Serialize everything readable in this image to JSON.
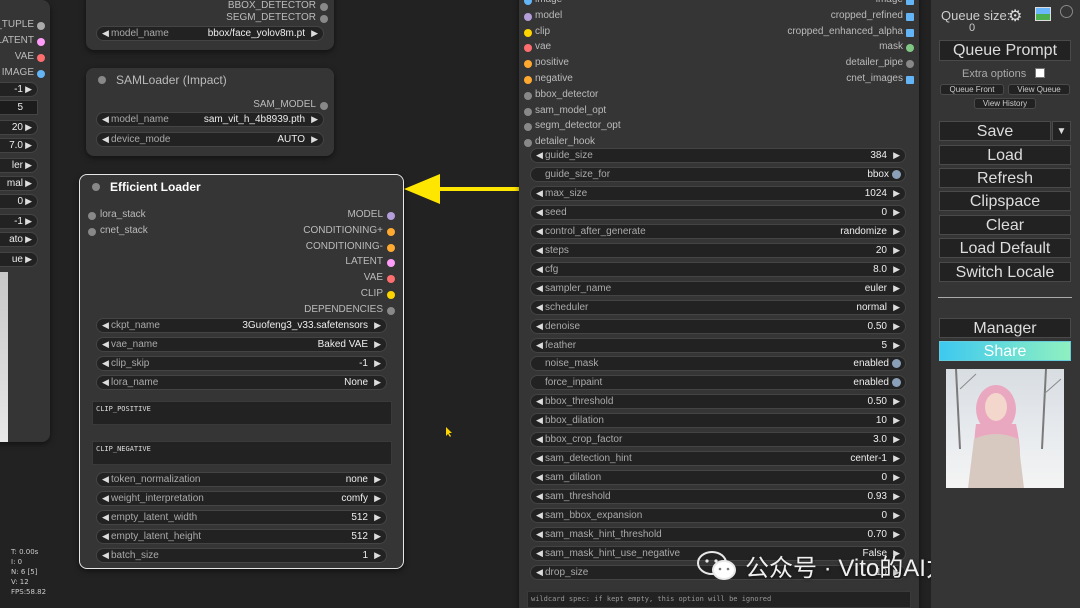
{
  "left_strip": {
    "outputs": [
      {
        "label": "_TUPLE",
        "color": "#aaaaaa"
      },
      {
        "label": "LATENT",
        "color": "#ff9cf9"
      },
      {
        "label": "VAE",
        "color": "#ff6e6e"
      },
      {
        "label": "IMAGE",
        "color": "#64b5f6"
      }
    ],
    "widget_values": [
      "-1",
      "5",
      "20",
      "7.0",
      "ler",
      "mal",
      "0",
      "-1",
      "ato",
      "ue"
    ]
  },
  "top_node": {
    "outputs": [
      "BBOX_DETECTOR",
      "SEGM_DETECTOR"
    ],
    "model_name_label": "model_name",
    "model_name_value": "bbox/face_yolov8m.pt"
  },
  "sam_loader": {
    "title": "SAMLoader (Impact)",
    "output": "SAM_MODEL",
    "model_name_label": "model_name",
    "model_name_value": "sam_vit_h_4b8939.pth",
    "device_mode_label": "device_mode",
    "device_mode_value": "AUTO"
  },
  "efficient_loader": {
    "title": "Efficient Loader",
    "inputs": [
      "lora_stack",
      "cnet_stack"
    ],
    "outputs": [
      {
        "label": "MODEL",
        "color": "#b39ddb"
      },
      {
        "label": "CONDITIONING+",
        "color": "#ffa931"
      },
      {
        "label": "CONDITIONING-",
        "color": "#ffa931"
      },
      {
        "label": "LATENT",
        "color": "#ff9cf9"
      },
      {
        "label": "VAE",
        "color": "#ff6e6e"
      },
      {
        "label": "CLIP",
        "color": "#ffd500"
      },
      {
        "label": "DEPENDENCIES",
        "color": "#888888"
      }
    ],
    "widgets_top": [
      {
        "label": "ckpt_name",
        "value": "3Guofeng3_v33.safetensors"
      },
      {
        "label": "vae_name",
        "value": "Baked VAE"
      },
      {
        "label": "clip_skip",
        "value": "-1"
      },
      {
        "label": "lora_name",
        "value": "None"
      }
    ],
    "clip_positive_label": "CLIP_POSITIVE",
    "clip_negative_label": "CLIP_NEGATIVE",
    "widgets_bottom": [
      {
        "label": "token_normalization",
        "value": "none"
      },
      {
        "label": "weight_interpretation",
        "value": "comfy"
      },
      {
        "label": "empty_latent_width",
        "value": "512"
      },
      {
        "label": "empty_latent_height",
        "value": "512"
      },
      {
        "label": "batch_size",
        "value": "1"
      }
    ]
  },
  "detailer_node": {
    "top_inputs": [
      {
        "label": "image",
        "color": "#64b5f6"
      },
      {
        "label": "model",
        "color": "#b39ddb"
      },
      {
        "label": "clip",
        "color": "#ffd500"
      },
      {
        "label": "vae",
        "color": "#ff6e6e"
      },
      {
        "label": "positive",
        "color": "#ffa931"
      },
      {
        "label": "negative",
        "color": "#ffa931"
      },
      {
        "label": "bbox_detector",
        "color": "#888888"
      },
      {
        "label": "sam_model_opt",
        "color": "#888888"
      },
      {
        "label": "segm_detector_opt",
        "color": "#888888"
      },
      {
        "label": "detailer_hook",
        "color": "#888888"
      }
    ],
    "top_outputs": [
      {
        "label": "image",
        "color": "#64b5f6"
      },
      {
        "label": "cropped_refined",
        "color": "#64b5f6"
      },
      {
        "label": "cropped_enhanced_alpha",
        "color": "#64b5f6"
      },
      {
        "label": "mask",
        "color": "#81c784"
      },
      {
        "label": "detailer_pipe",
        "color": "#888888"
      },
      {
        "label": "cnet_images",
        "color": "#64b5f6"
      }
    ],
    "widgets": [
      {
        "label": "guide_size",
        "value": "384",
        "toggle": false
      },
      {
        "label": "guide_size_for",
        "value": "bbox",
        "toggle": true
      },
      {
        "label": "max_size",
        "value": "1024",
        "toggle": false
      },
      {
        "label": "seed",
        "value": "0",
        "toggle": false
      },
      {
        "label": "control_after_generate",
        "value": "randomize",
        "toggle": false
      },
      {
        "label": "steps",
        "value": "20",
        "toggle": false
      },
      {
        "label": "cfg",
        "value": "8.0",
        "toggle": false
      },
      {
        "label": "sampler_name",
        "value": "euler",
        "toggle": false
      },
      {
        "label": "scheduler",
        "value": "normal",
        "toggle": false
      },
      {
        "label": "denoise",
        "value": "0.50",
        "toggle": false
      },
      {
        "label": "feather",
        "value": "5",
        "toggle": false
      },
      {
        "label": "noise_mask",
        "value": "enabled",
        "toggle": true
      },
      {
        "label": "force_inpaint",
        "value": "enabled",
        "toggle": true
      },
      {
        "label": "bbox_threshold",
        "value": "0.50",
        "toggle": false
      },
      {
        "label": "bbox_dilation",
        "value": "10",
        "toggle": false
      },
      {
        "label": "bbox_crop_factor",
        "value": "3.0",
        "toggle": false
      },
      {
        "label": "sam_detection_hint",
        "value": "center-1",
        "toggle": false
      },
      {
        "label": "sam_dilation",
        "value": "0",
        "toggle": false
      },
      {
        "label": "sam_threshold",
        "value": "0.93",
        "toggle": false
      },
      {
        "label": "sam_bbox_expansion",
        "value": "0",
        "toggle": false
      },
      {
        "label": "sam_mask_hint_threshold",
        "value": "0.70",
        "toggle": false
      },
      {
        "label": "sam_mask_hint_use_negative",
        "value": "False",
        "toggle": false
      },
      {
        "label": "drop_size",
        "value": "10",
        "toggle": false
      }
    ],
    "wildcard_text": "wildcard spec: if kept empty, this option will be ignored"
  },
  "menu": {
    "queue_size_label": "Queue size:",
    "queue_size_value": "0",
    "queue_prompt": "Queue Prompt",
    "extra_options": "Extra options",
    "queue_front": "Queue Front",
    "view_queue": "View Queue",
    "view_history": "View History",
    "save": "Save",
    "load": "Load",
    "refresh": "Refresh",
    "clipspace": "Clipspace",
    "clear": "Clear",
    "load_default": "Load Default",
    "switch_locale": "Switch Locale",
    "manager": "Manager",
    "share": "Share"
  },
  "stats": [
    "T: 0.00s",
    "I: 0",
    "N: 6 [5]",
    "V: 12",
    "FPS:58.82"
  ],
  "watermark": "公众号 · Vito的AI力量",
  "colors": {
    "accent_arrow": "#ffe600",
    "share_gradient_start": "#3ec9f0",
    "share_gradient_end": "#8ff0c0"
  }
}
